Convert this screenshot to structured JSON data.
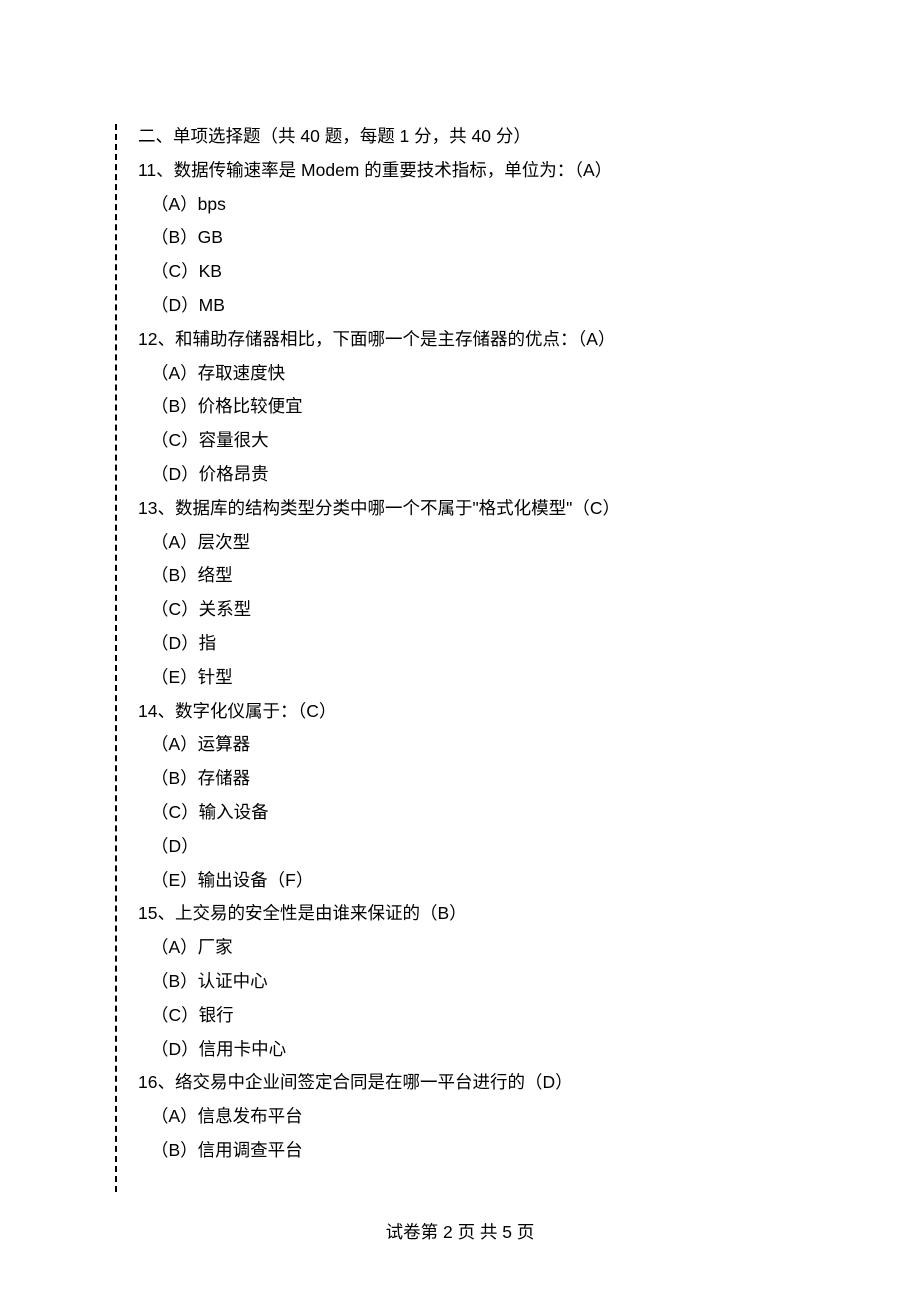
{
  "section_header": "二、单项选择题（共 40 题，每题 1 分，共 40 分）",
  "questions": [
    {
      "stem": "11、数据传输速率是 Modem 的重要技术指标，单位为：（A）",
      "options": [
        "（A）bps",
        "（B）GB",
        "（C）KB",
        "（D）MB"
      ]
    },
    {
      "stem": "12、和辅助存储器相比，下面哪一个是主存储器的优点：（A）",
      "options": [
        "（A）存取速度快",
        "（B）价格比较便宜",
        "（C）容量很大",
        "（D）价格昂贵"
      ]
    },
    {
      "stem": "13、数据库的结构类型分类中哪一个不属于\"格式化模型\"（C）",
      "options": [
        "（A）层次型",
        "（B）络型",
        "（C）关系型",
        "（D）指",
        "（E）针型"
      ]
    },
    {
      "stem": "14、数字化仪属于：（C）",
      "options": [
        "（A）运算器",
        "（B）存储器",
        "（C）输入设备",
        "（D）",
        "（E）输出设备（F）"
      ]
    },
    {
      "stem": "15、上交易的安全性是由谁来保证的（B）",
      "options": [
        "（A）厂家",
        "（B）认证中心",
        "（C）银行",
        "（D）信用卡中心"
      ]
    },
    {
      "stem": "16、络交易中企业间签定合同是在哪一平台进行的（D）",
      "options": [
        "（A）信息发布平台",
        "（B）信用调查平台"
      ]
    }
  ],
  "footer": "试卷第 2 页 共 5 页"
}
